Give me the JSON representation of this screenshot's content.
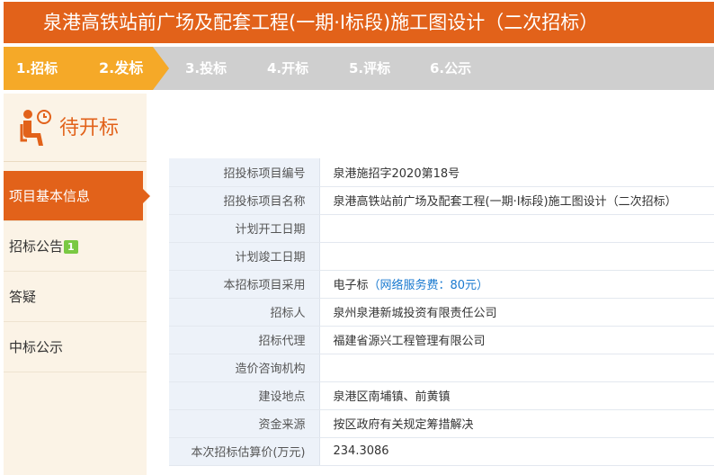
{
  "header": {
    "title": "泉港高铁站前广场及配套工程(一期·Ⅰ标段)施工图设计（二次招标）"
  },
  "steps": [
    {
      "label": "1.招标",
      "done": true
    },
    {
      "label": "2.发标",
      "done": true
    },
    {
      "label": "3.投标",
      "done": false
    },
    {
      "label": "4.开标",
      "done": false
    },
    {
      "label": "5.评标",
      "done": false
    },
    {
      "label": "6.公示",
      "done": false
    }
  ],
  "status": {
    "text": "待开标",
    "icon": "waiting-person-clock-icon"
  },
  "sidebar": {
    "items": [
      {
        "label": "项目基本信息",
        "active": true
      },
      {
        "label": "招标公告",
        "badge": "1"
      },
      {
        "label": "答疑"
      },
      {
        "label": "中标公示"
      }
    ]
  },
  "info": {
    "rows": [
      {
        "key": "招投标项目编号",
        "value": "泉港施招字2020第18号"
      },
      {
        "key": "招投标项目名称",
        "value": "泉港高铁站前广场及配套工程(一期·Ⅰ标段)施工图设计（二次招标）"
      },
      {
        "key": "计划开工日期",
        "value": ""
      },
      {
        "key": "计划竣工日期",
        "value": ""
      },
      {
        "key": "本招标项目采用",
        "value": "电子标",
        "fee": "（网络服务费：80元）"
      },
      {
        "key": "招标人",
        "value": "泉州泉港新城投资有限责任公司"
      },
      {
        "key": "招标代理",
        "value": "福建省源兴工程管理有限公司"
      },
      {
        "key": "造价咨询机构",
        "value": ""
      },
      {
        "key": "建设地点",
        "value": "泉港区南埔镇、前黄镇"
      },
      {
        "key": "资金来源",
        "value": "按区政府有关规定筹措解决"
      },
      {
        "key": "本次招标估算价(万元)",
        "value": "234.3086"
      }
    ]
  },
  "colors": {
    "accent": "#e2621a",
    "step_done": "#f5a928",
    "step_todo": "#cfcfcf",
    "badge": "#7ac943",
    "link": "#1a7ad0"
  }
}
